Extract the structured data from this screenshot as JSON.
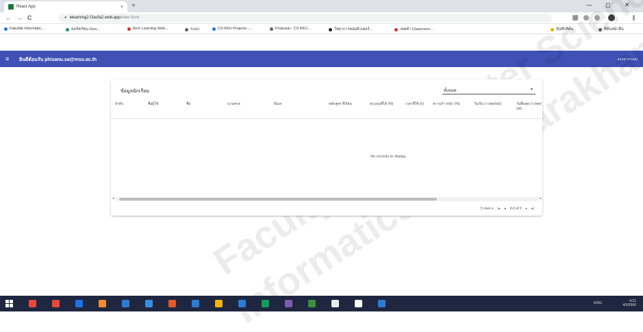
{
  "browser": {
    "tab_title": "React App",
    "tab_close": "×",
    "new_tab": "+",
    "window_controls": {
      "minimize": "—",
      "maximize": "◻",
      "close": "✕"
    },
    "nav": {
      "back": "←",
      "forward": "→",
      "reload": "C"
    },
    "url_host": "elearning2-f1ecfa2.web.app",
    "url_path": "/view-form"
  },
  "bookmarks": [
    {
      "label": "Fakultät Informatio...",
      "color": "#1a73e8"
    },
    {
      "label": "คอร์สเรียน Goo...",
      "color": "#0f9d58"
    },
    {
      "label": "Arch Learning Web...",
      "color": "#d93025"
    },
    {
      "label": "ระบบ",
      "color": "#5f6368"
    },
    {
      "label": "CS-KKU Projects -...",
      "color": "#1a73e8"
    },
    {
      "label": "Proposal - CS KKU...",
      "color": "#5f6368"
    },
    {
      "label": "วิทยาการคอมพิวเตอร์...",
      "color": "#202124"
    },
    {
      "label": "เขตคำ Classroom...",
      "color": "#d93025"
    },
    {
      "label": "บันทึกที่คั่น",
      "color": "#f9ab00"
    },
    {
      "label": "ที่คั่นหน้าอื่น",
      "color": "#5f6368"
    }
  ],
  "appbar": {
    "menu_icon": "≡",
    "title": "ยินดีต้อนรับ phisanu.sa@msu.ac.th",
    "logout": "ออกจากระบบ",
    "color": "#3f51b5"
  },
  "card": {
    "title": "ข้อมูลนักเรียน",
    "filter_value": "ทั้งหมด",
    "filter_caret": "▾",
    "columns": [
      "ลำดับ",
      "ชื่อผู้ใช้",
      "ชื่อ",
      "นามสกุล",
      "อีเมล",
      "หลักสูตร ที่เรียน",
      "คะแนนที่ได้ (%)",
      "เวลาที่ใช้ (s)",
      "ความก้าวหน้า (%)",
      "วันเริ่ม (วว/ดด/ปป)",
      "วันสิ้นสุด (วว/ดด/ปป)"
    ],
    "empty_message": "No records to display",
    "scroll_left": "◂",
    "scroll_right": "▸",
    "pager": {
      "rows": "5 rows ▾",
      "first": "|◂",
      "prev": "◂",
      "range": "0-0 of 0",
      "next": "▸",
      "last": "▸|"
    }
  },
  "watermark": [
    "Faculty of Computer Science, Department of",
    "Informatics, Mahasarakham"
  ],
  "taskbar": {
    "icons": [
      "#e8483b",
      "#e8483b",
      "#1a73e8",
      "#f28b30",
      "#2d7bd6",
      "#3a8dde",
      "#e05a2b",
      "#2d7bd6",
      "#f4b400",
      "#2d7bd6",
      "#0f9d58",
      "#7b5ea7",
      "#3c8d3c",
      "#e8eaed",
      "#ffffff",
      "#2d7bd6"
    ],
    "tray_status": "ENG",
    "time": "4:21",
    "date": "4/9/2566"
  }
}
